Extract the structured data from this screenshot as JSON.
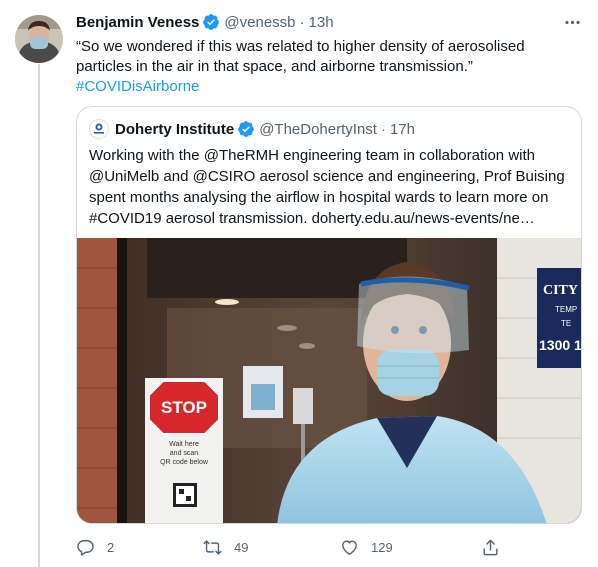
{
  "tweet": {
    "author_name": "Benjamin Veness",
    "author_handle": "@venessb",
    "separator": "·",
    "timestamp": "13h",
    "text_line1": "“So we wondered if this was related to higher density of aerosolised",
    "text_line2": "particles in the air in that space, and airborne transmission.”",
    "hashtag": "#COVIDisAirborne",
    "verified": true
  },
  "quoted_tweet": {
    "author_name": "Doherty Institute",
    "author_handle": "@TheDohertyInst",
    "separator": "·",
    "timestamp": "17h",
    "verified": true,
    "text_lines": [
      "Working with the @TheRMH engineering team in collaboration with",
      "@UniMelb and @CSIRO aerosol science and engineering, Prof Buising",
      "spent months analysing the airflow in hospital wards to learn more on",
      "#COVID19 aerosol transmission.  doherty.edu.au/news-events/ne…"
    ],
    "image": {
      "sign_text": "STOP",
      "sign_subtext_lines": [
        "Wait here",
        "and scan",
        "QR code below"
      ],
      "background_sign_text": [
        "CITY",
        "TEMP",
        "TE",
        "1300 1"
      ]
    }
  },
  "actions": {
    "reply_count": "2",
    "retweet_count": "49",
    "like_count": "129"
  },
  "colors": {
    "accent": "#1d9bf0",
    "text": "#0f1419",
    "muted": "#536471",
    "border": "#cfd9de"
  },
  "icons": [
    "verified-badge-icon",
    "more-icon",
    "reply-icon",
    "retweet-icon",
    "like-icon",
    "share-icon"
  ]
}
